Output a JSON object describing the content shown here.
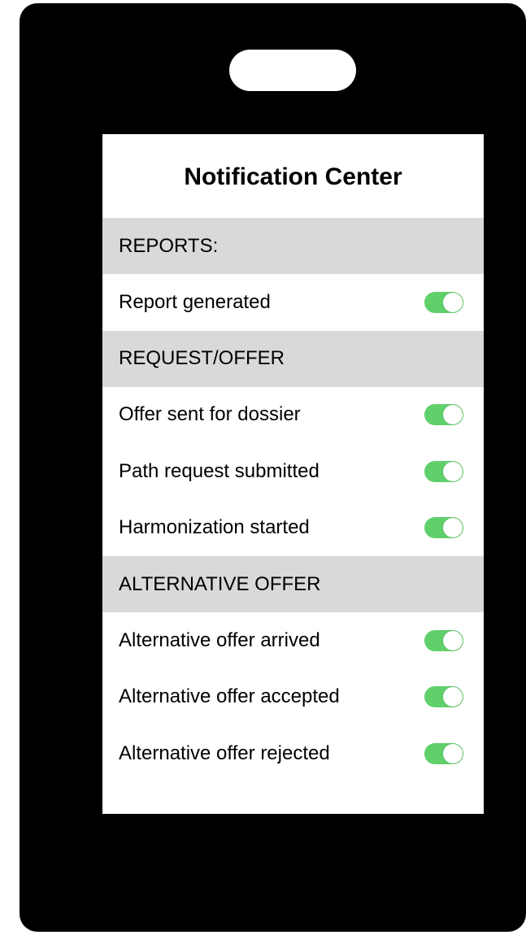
{
  "screen": {
    "title": "Notification Center"
  },
  "sections": [
    {
      "header": "REPORTS:",
      "items": [
        {
          "label": "Report generated",
          "enabled": true
        }
      ]
    },
    {
      "header": "REQUEST/OFFER",
      "items": [
        {
          "label": "Offer sent for dossier",
          "enabled": true
        },
        {
          "label": "Path request submitted",
          "enabled": true
        },
        {
          "label": "Harmonization started",
          "enabled": true
        }
      ]
    },
    {
      "header": "ALTERNATIVE OFFER",
      "items": [
        {
          "label": "Alternative offer arrived",
          "enabled": true
        },
        {
          "label": "Alternative offer accepted",
          "enabled": true
        },
        {
          "label": "Alternative offer rejected",
          "enabled": true
        }
      ]
    }
  ],
  "colors": {
    "toggle_on": "#5fd06a",
    "section_bg": "#d9d9d9",
    "phone_body": "#000000"
  }
}
